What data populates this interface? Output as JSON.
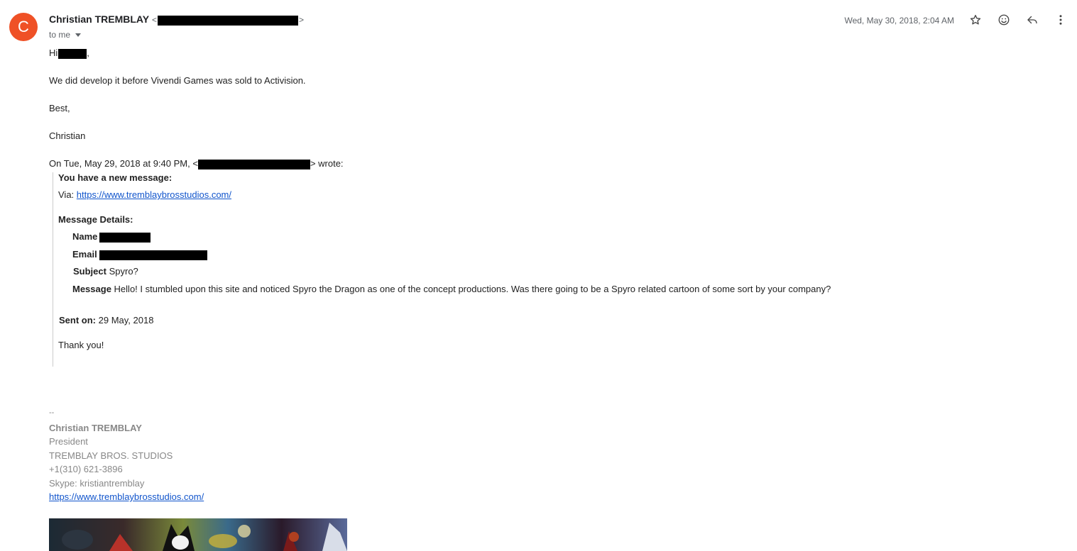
{
  "header": {
    "avatar_letter": "C",
    "sender_name": "Christian TREMBLAY",
    "sender_email_open": "<",
    "sender_email_close": ">",
    "to_label": "to me",
    "date": "Wed, May 30, 2018, 2:04 AM"
  },
  "actions": [
    {
      "name": "star-icon"
    },
    {
      "name": "emoji-icon"
    },
    {
      "name": "reply-icon"
    },
    {
      "name": "more-vert-icon"
    }
  ],
  "message": {
    "greeting": "Hi",
    "greeting_end": ",",
    "line1": "We did develop it before Vivendi Games was sold to Activision.",
    "closing": "Best,",
    "signoff": "Christian",
    "quote_intro_start": "On Tue, May 29, 2018 at 9:40 PM, <",
    "quote_intro_end": "> wrote:"
  },
  "quoted": {
    "heading": "You have a new message:",
    "via_label": "Via:",
    "via_link": "https://www.tremblaybrosstudios.com/",
    "details_heading": "Message Details:",
    "name_label": "Name",
    "email_label": "Email",
    "subject_label": "Subject",
    "subject_value": "Spyro?",
    "message_label": "Message",
    "message_value": "Hello! I stumbled upon this site and noticed Spyro the Dragon as one of the concept productions. Was there going to be a Spyro related cartoon of some sort by your company?",
    "sent_label": "Sent on:",
    "sent_value": "29 May, 2018",
    "thanks": "Thank you!"
  },
  "signature": {
    "separator": "--",
    "name": "Christian TREMBLAY",
    "title": "President",
    "company": "TREMBLAY BROS. STUDIOS",
    "phone": "+1(310) 621-3896",
    "skype": "Skype: kristiantremblay",
    "website": "https://www.tremblaybrosstudios.com/"
  },
  "colors": {
    "avatar": "#ef5126",
    "link": "#1155cc",
    "signature_text": "#888888"
  }
}
